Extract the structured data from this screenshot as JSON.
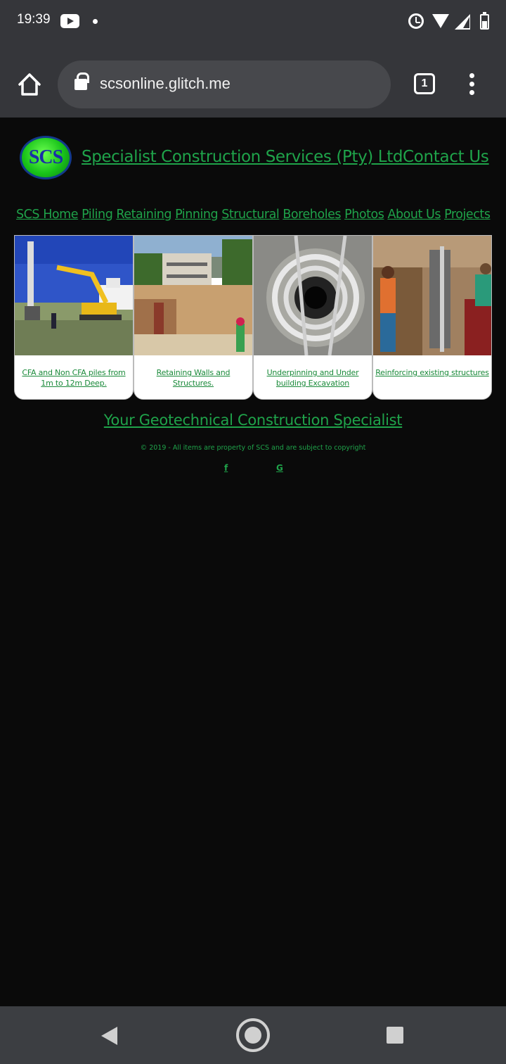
{
  "status_bar": {
    "time": "19:39",
    "icons": [
      "youtube-icon",
      "notification-dot-icon",
      "alarm-icon",
      "wifi-icon",
      "signal-icon",
      "battery-icon"
    ]
  },
  "browser": {
    "url": "scsonline.glitch.me",
    "tab_count": "1",
    "icons": [
      "home-icon",
      "lock-icon",
      "tab-switcher-icon",
      "more-menu-icon"
    ]
  },
  "header": {
    "logo_text": "SCS",
    "company_link": "Specialist Construction Services (Pty) Ltd",
    "contact_link": "Contact Us"
  },
  "nav": {
    "items": [
      "SCS Home",
      "Piling",
      "Retaining",
      "Pinning",
      "Structural",
      "Boreholes",
      "Photos",
      "About Us",
      "Projects"
    ]
  },
  "cards": [
    {
      "caption": "CFA and Non CFA piles from 1m to 12m Deep."
    },
    {
      "caption": "Retaining Walls and Structures."
    },
    {
      "caption": "Underpinning and Under building Excavation"
    },
    {
      "caption": "Reinforcing existing structures"
    }
  ],
  "footer": {
    "tagline": "Your Geotechnical Construction Specialist",
    "copyright": "© 2019 - All items are property of SCS and are subject to copyright",
    "social": [
      "f",
      "G"
    ]
  },
  "colors": {
    "link_green": "#1fa34a",
    "page_background": "#0a0a0a",
    "chrome_gray": "#35363a"
  }
}
